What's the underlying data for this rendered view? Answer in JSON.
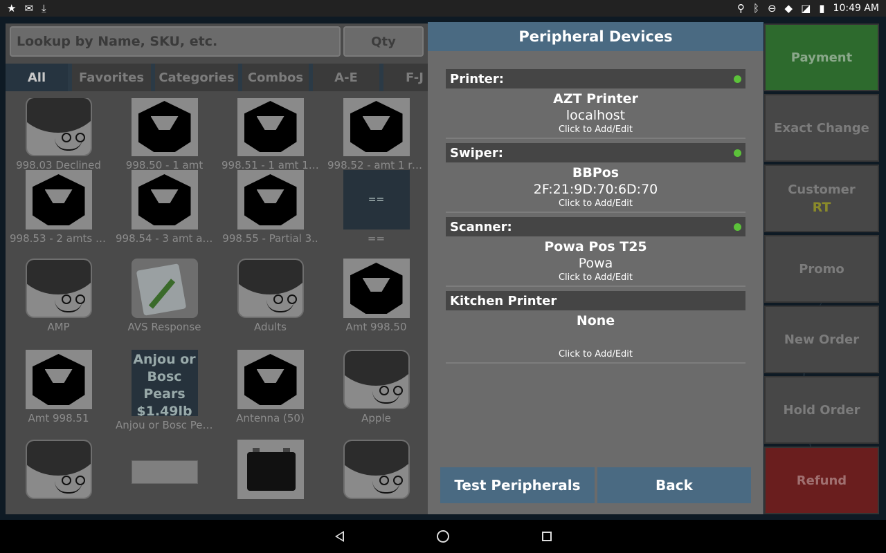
{
  "statusbar": {
    "left_icons": [
      "star-icon",
      "mail-icon",
      "download-icon"
    ],
    "right_icons": [
      "location-icon",
      "bluetooth-icon",
      "do-not-disturb-icon",
      "wifi-icon",
      "signal-off-icon",
      "battery-icon"
    ],
    "time": "10:49 AM"
  },
  "search": {
    "placeholder": "Lookup by Name, SKU, etc.",
    "qty_label": "Qty"
  },
  "tabs": [
    "All",
    "Favorites",
    "Categories",
    "Combos",
    "A-E",
    "F-J"
  ],
  "products": [
    {
      "label": "998.03 Declined",
      "thumb": "face"
    },
    {
      "label": "998.50 - 1 amt",
      "thumb": "cube"
    },
    {
      "label": "998.51 - 1 amt 1 re..",
      "thumb": "cube"
    },
    {
      "label": "998.52 - amt 1 rec..",
      "thumb": "cube"
    },
    {
      "label": "998.53 - 2 amts a..",
      "thumb": "cube"
    },
    {
      "label": "998.54 - 3 amt an..",
      "thumb": "cube"
    },
    {
      "label": "998.55 - Partial 3..",
      "thumb": "cube"
    },
    {
      "label": "==",
      "thumb": "dark",
      "thumb_text": "=="
    },
    {
      "label": "AMP",
      "thumb": "face"
    },
    {
      "label": "AVS Response",
      "thumb": "note"
    },
    {
      "label": "Adults",
      "thumb": "face"
    },
    {
      "label": "Amt 998.50",
      "thumb": "cube"
    },
    {
      "label": "Amt 998.51",
      "thumb": "cube"
    },
    {
      "label": "Anjou or Bosc Pea..",
      "thumb": "text",
      "thumb_text": "Anjou or Bosc Pears $1.49lb"
    },
    {
      "label": "Antenna (50)",
      "thumb": "cube"
    },
    {
      "label": "Apple",
      "thumb": "face"
    },
    {
      "label": "",
      "thumb": "face"
    },
    {
      "label": "",
      "thumb": "keyboard"
    },
    {
      "label": "",
      "thumb": "battery"
    },
    {
      "label": "",
      "thumb": "face"
    }
  ],
  "dialog": {
    "title": "Peripheral Devices",
    "sections": [
      {
        "header": "Printer:",
        "connected": true,
        "name": "AZT Printer",
        "detail": "localhost",
        "link": "Click to Add/Edit"
      },
      {
        "header": "Swiper:",
        "connected": true,
        "name": "BBPos",
        "detail": "2F:21:9D:70:6D:70",
        "link": "Click to Add/Edit"
      },
      {
        "header": "Scanner:",
        "connected": true,
        "name": "Powa Pos T25",
        "detail": "Powa",
        "link": "Click to Add/Edit"
      },
      {
        "header": "Kitchen Printer",
        "connected": false,
        "name": "None",
        "detail": "",
        "link": "Click to Add/Edit"
      }
    ],
    "test_label": "Test Peripherals",
    "back_label": "Back",
    "status_color": "#5cc23a"
  },
  "actions": [
    {
      "label": "Payment",
      "style": "green"
    },
    {
      "label": "Exact Change",
      "style": ""
    },
    {
      "label": "Customer",
      "sub": "RT",
      "style": ""
    },
    {
      "label": "Promo",
      "style": ""
    },
    {
      "label": "New Order",
      "style": ""
    },
    {
      "label": "Hold Order",
      "style": ""
    },
    {
      "label": "Refund",
      "style": "red"
    }
  ],
  "navbar": [
    "back-icon",
    "home-icon",
    "recents-icon"
  ]
}
